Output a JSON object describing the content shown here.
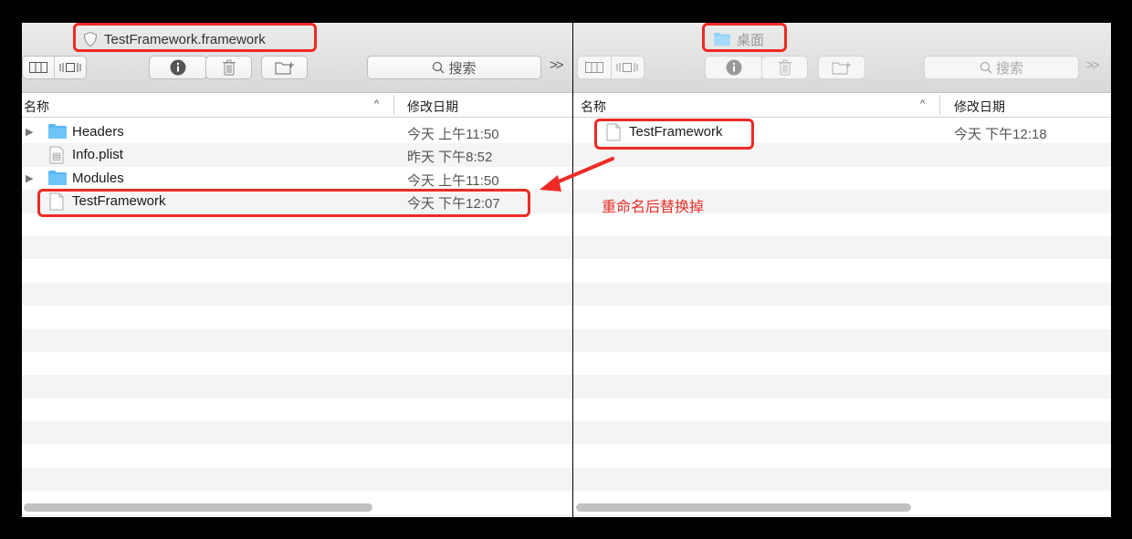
{
  "left_window": {
    "title": "TestFramework.framework",
    "search_placeholder": "搜索",
    "overflow_label": ">>",
    "columns": {
      "name": "名称",
      "date": "修改日期"
    },
    "files": [
      {
        "name": "Headers",
        "date": "今天 上午11:50",
        "kind": "folder",
        "expandable": true
      },
      {
        "name": "Info.plist",
        "date": "昨天 下午8:52",
        "kind": "plist",
        "expandable": false
      },
      {
        "name": "Modules",
        "date": "今天 上午11:50",
        "kind": "folder",
        "expandable": true
      },
      {
        "name": "TestFramework",
        "date": "今天 下午12:07",
        "kind": "document",
        "expandable": false
      }
    ]
  },
  "right_window": {
    "title": "桌面",
    "search_placeholder": "搜索",
    "overflow_label": ">>",
    "columns": {
      "name": "名称",
      "date": "修改日期"
    },
    "files": [
      {
        "name": "TestFramework",
        "date": "今天 下午12:18",
        "kind": "document",
        "expandable": false
      }
    ]
  },
  "annotation": {
    "text": "重命名后替换掉",
    "color": "#e8322b"
  },
  "colors": {
    "highlight_box": "#ee2a24",
    "folder": "#57b7f4",
    "stripe": "#f4f4f4"
  }
}
